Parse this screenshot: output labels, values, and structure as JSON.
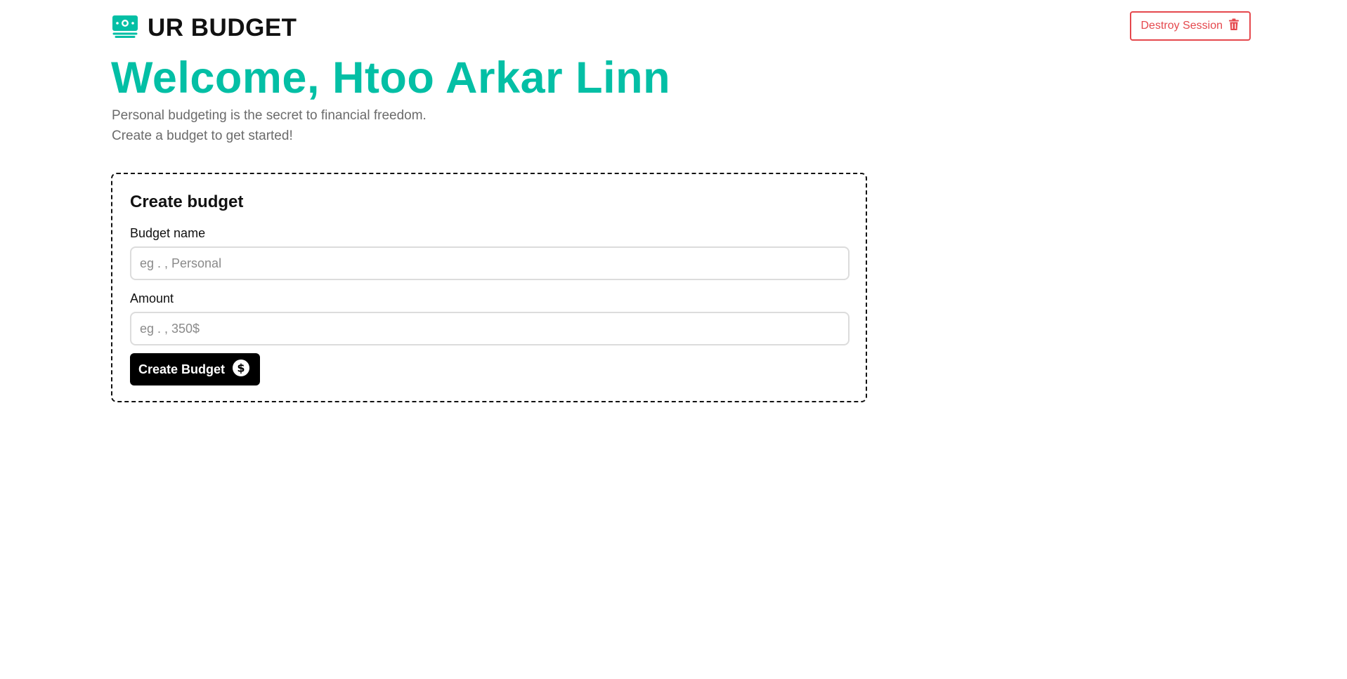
{
  "header": {
    "brand_name": "UR BUDGET",
    "brand_icon": "cash-icon",
    "destroy_label": "Destroy Session",
    "destroy_icon": "trash-icon"
  },
  "hero": {
    "title": "Welcome, Htoo Arkar Linn",
    "subtitle_line1": "Personal budgeting is the secret to financial freedom.",
    "subtitle_line2": "Create a budget to get started!"
  },
  "form": {
    "title": "Create budget",
    "budget_name_label": "Budget name",
    "budget_name_placeholder": "eg . , Personal",
    "budget_name_value": "",
    "amount_label": "Amount",
    "amount_placeholder": "eg . , 350$",
    "amount_value": "",
    "submit_label": "Create Budget",
    "submit_icon": "dollar-circle-icon"
  },
  "colors": {
    "accent": "#03bfa5",
    "danger": "#e5484d",
    "button_bg": "#000000",
    "muted_text": "#6b6b6b"
  }
}
